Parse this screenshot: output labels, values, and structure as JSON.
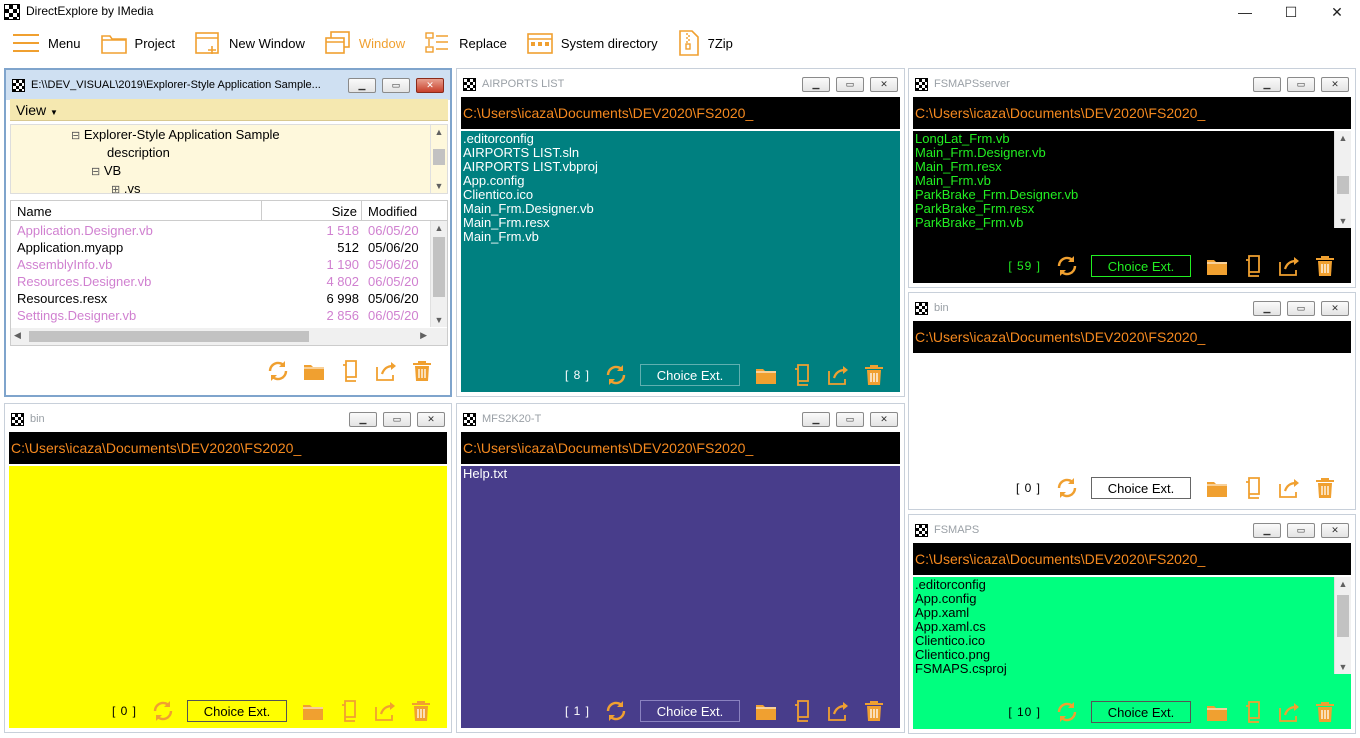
{
  "app": {
    "title": "DirectExplore by IMedia",
    "controls": {
      "minimize": "—",
      "maximize": "☐",
      "close": "✕"
    }
  },
  "toolbar": [
    {
      "label": "Menu",
      "icon": "menu-icon"
    },
    {
      "label": "Project",
      "icon": "folder-icon"
    },
    {
      "label": "New Window",
      "icon": "new-window-icon"
    },
    {
      "label": "Window",
      "icon": "window-icon"
    },
    {
      "label": "Replace",
      "icon": "replace-icon"
    },
    {
      "label": "System directory",
      "icon": "system-directory-icon"
    },
    {
      "label": "7Zip",
      "icon": "zip-icon"
    }
  ],
  "colors": {
    "accent": "#f0a030",
    "path_text": "#f5891f",
    "teal": "#008080",
    "yellow": "#ffff00",
    "purple": "#483d8b",
    "green": "#00ff7f",
    "black": "#000000",
    "file_pink": "#d080d0"
  },
  "win1": {
    "title": "E:\\\\DEV_VISUAL\\2019\\Explorer-Style Application Sample...",
    "view_label": "View",
    "tree": [
      {
        "label": "Explorer-Style Application Sample",
        "expander": "⊟"
      },
      {
        "label": "description",
        "expander": ""
      },
      {
        "label": "VB",
        "expander": "⊟"
      },
      {
        "label": ".vs",
        "expander": "⊞"
      }
    ],
    "columns": {
      "name": "Name",
      "size": "Size",
      "modified": "Modified"
    },
    "rows": [
      {
        "name": "Application.Designer.vb",
        "size": "1 518",
        "modified": "06/05/20",
        "color": "#d080d0"
      },
      {
        "name": "Application.myapp",
        "size": "512",
        "modified": "05/06/20",
        "color": "#000000"
      },
      {
        "name": "AssemblyInfo.vb",
        "size": "1 190",
        "modified": "05/06/20",
        "color": "#d080d0"
      },
      {
        "name": "Resources.Designer.vb",
        "size": "4 802",
        "modified": "06/05/20",
        "color": "#d080d0"
      },
      {
        "name": "Resources.resx",
        "size": "6 998",
        "modified": "05/06/20",
        "color": "#000000"
      },
      {
        "name": "Settings.Designer.vb",
        "size": "2 856",
        "modified": "06/05/20",
        "color": "#d080d0"
      }
    ]
  },
  "win2": {
    "title": "AIRPORTS LIST",
    "path": "C:\\Users\\icaza\\Documents\\DEV2020\\FS2020_",
    "files": [
      ".editorconfig",
      "AIRPORTS LIST.sln",
      "AIRPORTS LIST.vbproj",
      "App.config",
      "Clientico.ico",
      "Main_Frm.Designer.vb",
      "Main_Frm.resx",
      "Main_Frm.vb"
    ],
    "count": "[ 8 ]",
    "choice": "Choice Ext."
  },
  "win3": {
    "title": "FSMAPSserver",
    "path": "C:\\Users\\icaza\\Documents\\DEV2020\\FS2020_",
    "files": [
      "LongLat_Frm.vb",
      "Main_Frm.Designer.vb",
      "Main_Frm.resx",
      "Main_Frm.vb",
      "ParkBrake_Frm.Designer.vb",
      "ParkBrake_Frm.resx",
      "ParkBrake_Frm.vb"
    ],
    "count": "[ 59 ]",
    "choice": "Choice Ext."
  },
  "win4": {
    "title": "bin",
    "path": "C:\\Users\\icaza\\Documents\\DEV2020\\FS2020_",
    "files": [],
    "count": "[ 0 ]",
    "choice": "Choice Ext."
  },
  "win5": {
    "title": "bin",
    "path": "C:\\Users\\icaza\\Documents\\DEV2020\\FS2020_",
    "files": [],
    "count": "[ 0 ]",
    "choice": "Choice Ext."
  },
  "win6": {
    "title": "MFS2K20-T",
    "path": "C:\\Users\\icaza\\Documents\\DEV2020\\FS2020_",
    "files": [
      "Help.txt"
    ],
    "count": "[ 1 ]",
    "choice": "Choice Ext."
  },
  "win7": {
    "title": "FSMAPS",
    "path": "C:\\Users\\icaza\\Documents\\DEV2020\\FS2020_",
    "files": [
      ".editorconfig",
      "App.config",
      "App.xaml",
      "App.xaml.cs",
      "Clientico.ico",
      "Clientico.png",
      "FSMAPS.csproj"
    ],
    "count": "[ 10 ]",
    "choice": "Choice Ext."
  },
  "subwin_controls": {
    "minimize": "▁",
    "maximize": "▭",
    "close": "✕"
  }
}
